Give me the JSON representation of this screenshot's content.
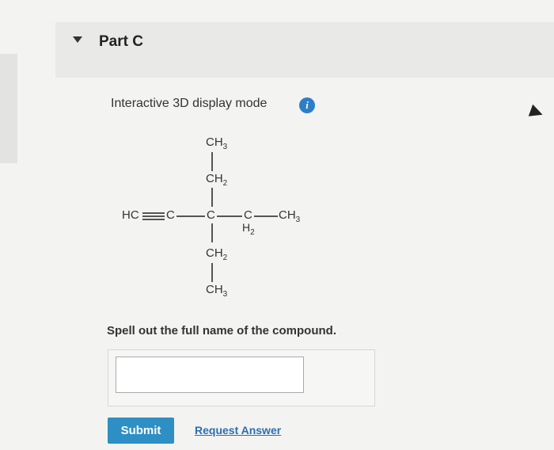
{
  "part": {
    "title": "Part C",
    "collapse_icon": "triangle-down-icon"
  },
  "display_mode": {
    "label": "Interactive 3D display mode",
    "info_icon": "info-icon",
    "info_glyph": "i"
  },
  "molecule": {
    "top_methyl": "CH",
    "top_methyl_sub": "3",
    "top_methylene": "CH",
    "top_methylene_sub": "2",
    "alkyne_group": "HC",
    "carbon_alkyne": "C",
    "carbon_center": "C",
    "carbon_chain": "C",
    "chain_h": "H",
    "chain_h_sub": "2",
    "chain_end": "CH",
    "chain_end_sub": "3",
    "bottom_methylene": "CH",
    "bottom_methylene_sub": "2",
    "bottom_methyl": "CH",
    "bottom_methyl_sub": "3"
  },
  "question": {
    "prompt": "Spell out the full name of the compound.",
    "answer_value": "",
    "answer_placeholder": ""
  },
  "actions": {
    "submit_label": "Submit",
    "request_answer_label": "Request Answer"
  }
}
